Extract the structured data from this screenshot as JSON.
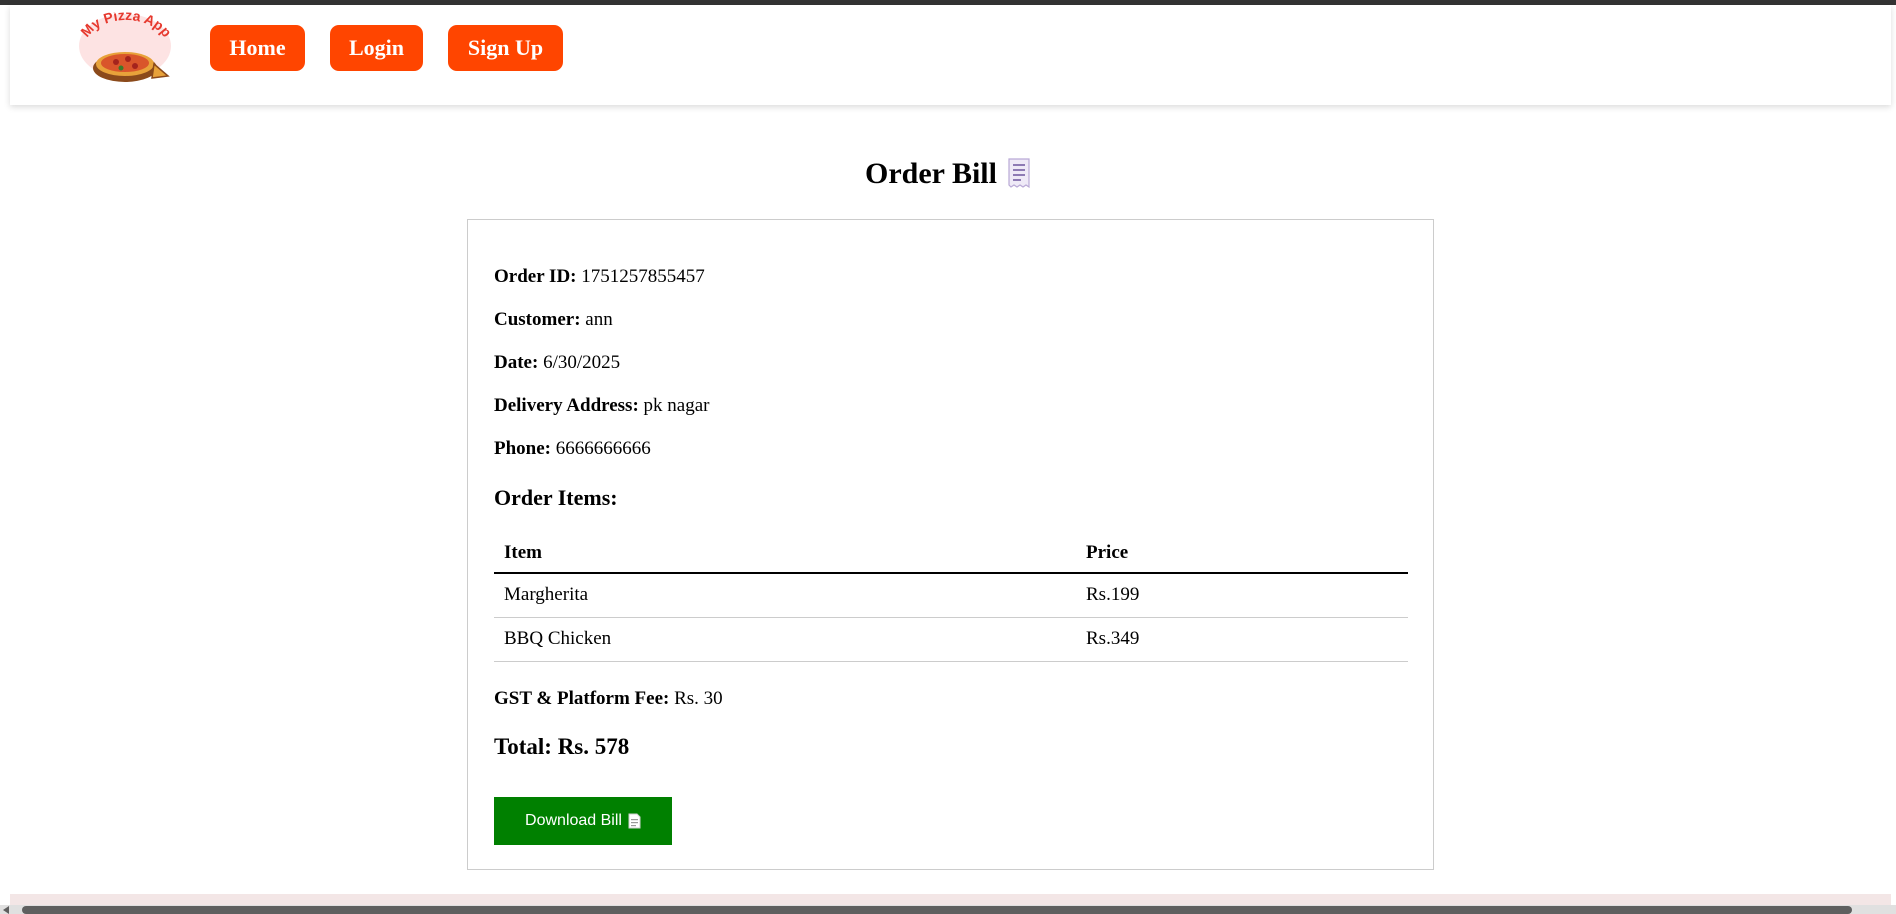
{
  "logo": {
    "text": "My Pizza App",
    "icon": "pizza-icon"
  },
  "nav": {
    "home": "Home",
    "login": "Login",
    "signup": "Sign Up"
  },
  "page_title": "Order Bill",
  "order": {
    "id_label": "Order ID:",
    "id_value": "1751257855457",
    "customer_label": "Customer:",
    "customer_value": "ann",
    "date_label": "Date:",
    "date_value": "6/30/2025",
    "address_label": "Delivery Address:",
    "address_value": "pk nagar",
    "phone_label": "Phone:",
    "phone_value": "6666666666"
  },
  "items_heading": "Order Items:",
  "table": {
    "headers": [
      "Item",
      "Price"
    ],
    "rows": [
      [
        "Margherita",
        "Rs.199"
      ],
      [
        "BBQ Chicken",
        "Rs.349"
      ]
    ]
  },
  "fee_label": "GST & Platform Fee:",
  "fee_value": "Rs. 30",
  "total": "Total: Rs. 578",
  "download_label": "Download Bill",
  "colors": {
    "nav_button": "#ff4500",
    "download_button": "#008000"
  }
}
